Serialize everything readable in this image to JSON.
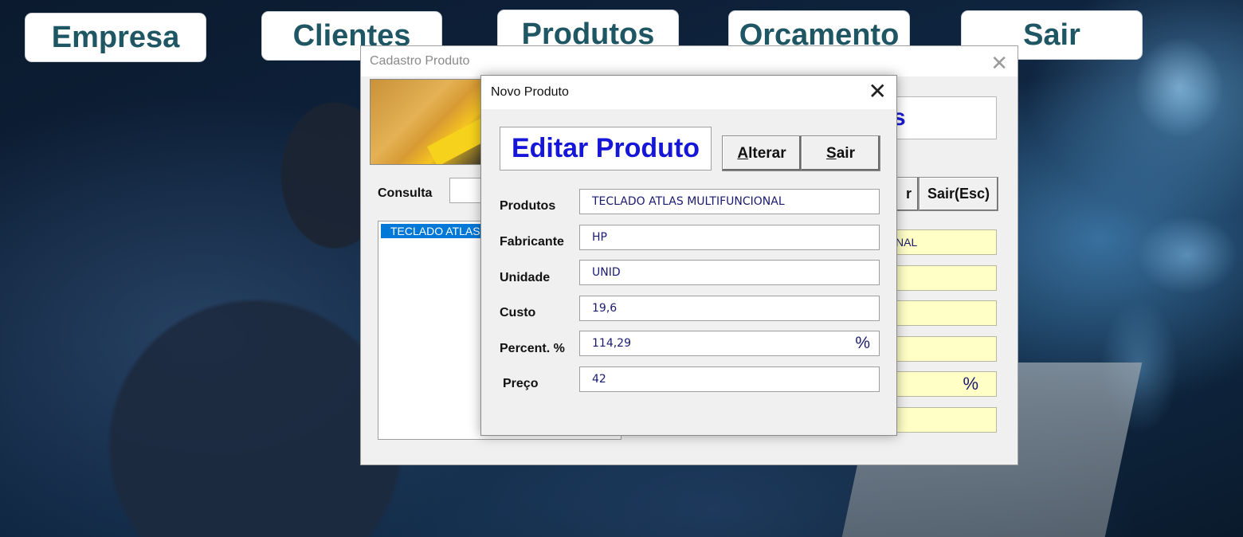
{
  "menu": {
    "empresa": "Empresa",
    "clientes": "Clientes",
    "produtos": "Produtos",
    "orcamento": "Orcamento",
    "sair": "Sair"
  },
  "cadastro": {
    "title": "Cadastro Produto",
    "close": "✕",
    "title_box_fragment": "s",
    "consulta_label": "Consulta",
    "consulta_value": "",
    "btn_partial": "r",
    "btn_sair_esc": "Sair(Esc)",
    "list_items": [
      "TECLADO ATLAS"
    ],
    "fields": [
      "NAL",
      "",
      "",
      "",
      "",
      ""
    ],
    "pct_symbol": "%"
  },
  "novo": {
    "title": "Novo Produto",
    "close": "✕",
    "header": "Editar Produto",
    "alterar_label": "Alterar",
    "alterar_mnemonic": "A",
    "alterar_rest": "lterar",
    "sair_mnemonic": "S",
    "sair_rest": "air",
    "fields": {
      "produtos": {
        "label": "Produtos",
        "value": "TECLADO ATLAS MULTIFUNCIONAL"
      },
      "fabricante": {
        "label": "Fabricante",
        "value": "HP"
      },
      "unidade": {
        "label": "Unidade",
        "value": "UNID"
      },
      "custo": {
        "label": "Custo",
        "value": "19,6"
      },
      "percent": {
        "label": "Percent. %",
        "value": "114,29",
        "suffix": "%"
      },
      "preco": {
        "label": "Preço",
        "value": "42"
      }
    }
  }
}
